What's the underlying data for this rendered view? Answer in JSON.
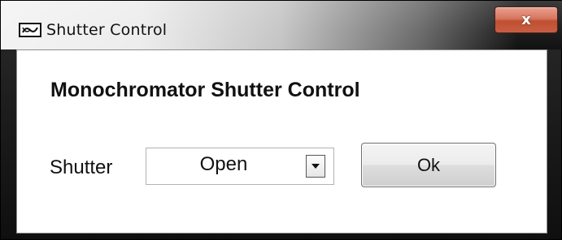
{
  "window": {
    "title": "Shutter Control",
    "icon": "app-window-icon",
    "close_glyph": "x"
  },
  "dialog": {
    "heading": "Monochromator Shutter Control",
    "shutter_label": "Shutter",
    "shutter_select": {
      "selected_value": "Open",
      "arrow_icon": "dropdown-arrow-icon"
    },
    "ok_label": "Ok"
  },
  "colors": {
    "close_button": "#c75d45",
    "client_background": "#ffffff",
    "frame": "#1a1a1a"
  }
}
